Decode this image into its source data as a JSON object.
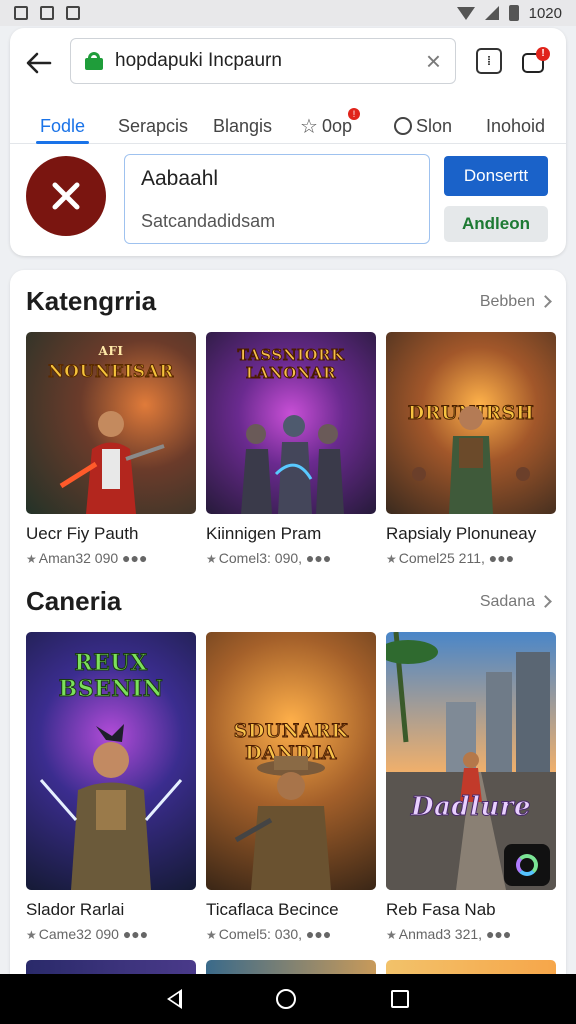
{
  "status_bar": {
    "time": "1020"
  },
  "search": {
    "text": "hopdapuki Incpaurn"
  },
  "tabs": [
    {
      "label": "Fodle",
      "active": true
    },
    {
      "label": "Serapcis"
    },
    {
      "label": "Blangis"
    },
    {
      "label": "0op",
      "badge": "!"
    },
    {
      "label": "Slon"
    },
    {
      "label": "Inohoid"
    }
  ],
  "app": {
    "title": "Aabaahl",
    "subtitle": "Satcandadidsam",
    "primary_button": "Donsertt",
    "secondary_button": "Andleon"
  },
  "sections": [
    {
      "title": "Katengrria",
      "see_more": "Bebben",
      "games": [
        {
          "name": "Uecr Fiy Pauth",
          "meta": "Aman32 090 ●●●",
          "logo": "NOUNEISAR",
          "logo_top": "AFI"
        },
        {
          "name": "Kiinnigen Pram",
          "meta": "Comel3: 090, ●●●",
          "logo": "TASSNIORK LANONAR"
        },
        {
          "name": "Rapsialy Plonuneay",
          "meta": "Comel25 211, ●●●",
          "logo": "DRUNIRSH"
        }
      ]
    },
    {
      "title": "Caneria",
      "see_more": "Sadana",
      "games": [
        {
          "name": "Slador Rarlai",
          "meta": "Came32 090 ●●●",
          "logo": "REUX BSENIN"
        },
        {
          "name": "Ticaflaca Becince",
          "meta": "Comel5: 030, ●●●",
          "logo": "SDUNARK DANDIA"
        },
        {
          "name": "Reb Fasa Nab",
          "meta": "Anmad3 321, ●●●",
          "logo": "Dadlure"
        }
      ]
    }
  ],
  "colors": {
    "accent": "#1a73e8",
    "primary_button": "#1a62c9",
    "secondary_text": "#1d7a33",
    "app_icon": "#7a1510",
    "badge": "#e0241b"
  }
}
